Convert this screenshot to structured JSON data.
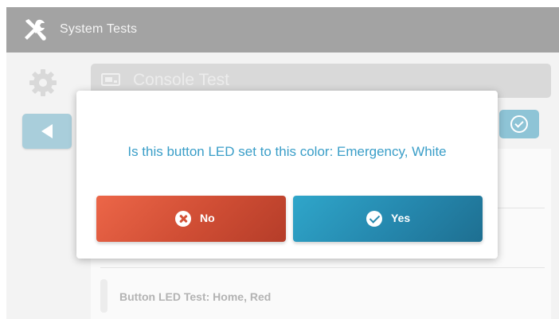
{
  "window": {
    "title": "System Tests",
    "icon": "tools-icon"
  },
  "sidebar": {
    "settings_icon": "gear-icon",
    "back_icon": "back-arrow-icon"
  },
  "panel": {
    "title": "Console Test",
    "icon": "monitor-icon",
    "confirm_icon": "check-circle-icon"
  },
  "list": {
    "items": [
      {
        "label": "Button LED Test: Home, Red"
      }
    ]
  },
  "dialog": {
    "question": "Is this button LED set to this color: Emergency, White",
    "no_label": "No",
    "yes_label": "Yes",
    "no_icon": "close-circle-icon",
    "yes_icon": "check-circle-icon",
    "colors": {
      "question_text": "#3a9ec8",
      "no_button": "#d4553a",
      "yes_button": "#2587ad"
    }
  },
  "colors": {
    "titlebar": "#a3a3a3",
    "accent_blue": "#a9cedb"
  }
}
